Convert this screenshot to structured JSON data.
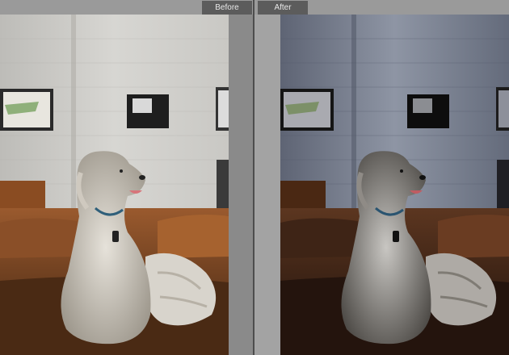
{
  "compare": {
    "before_label": "Before",
    "after_label": "After"
  },
  "colors": {
    "chrome": "#9a9a9a",
    "label_bg": "#5c5c5c",
    "label_text": "#e8e8e8"
  }
}
